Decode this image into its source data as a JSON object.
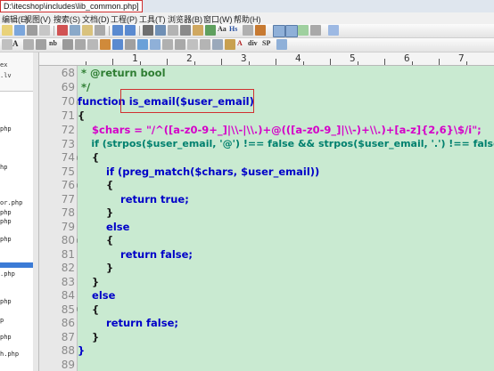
{
  "window": {
    "path": "D:\\itecshop\\includes\\lib_common.php]"
  },
  "menu": [
    "编辑(E)",
    "视图(V)",
    "搜索(S)",
    "文档(D)",
    "工程(P)",
    "工具(T)",
    "浏览器(B)",
    "窗口(W)",
    "帮助(H)"
  ],
  "toolbar": {
    "aa": "Aa",
    "hs": "Hs",
    "nb": "nb",
    "div": "div",
    "sp": "SP"
  },
  "sidebar": {
    "files": [
      "ex",
      ".lv",
      "",
      "php",
      "",
      "",
      "",
      "hp",
      "",
      "",
      "",
      "or.php",
      "php",
      "php",
      "",
      "php",
      "",
      "",
      "",
      "",
      ".php",
      "",
      "",
      "php",
      "",
      "p",
      "",
      "php",
      "",
      "h.php",
      ""
    ]
  },
  "ruler": {
    "labels": [
      "1",
      "2",
      "3",
      "4",
      "5",
      "6",
      "7"
    ]
  },
  "editor": {
    "lines": [
      {
        "n": "68",
        "text": " * @return bool"
      },
      {
        "n": "69",
        "text": " */"
      },
      {
        "n": "70",
        "text": "function is_email($user_email)"
      },
      {
        "n": "71",
        "text": "{"
      },
      {
        "n": "72",
        "text": "    $chars = \"/^([a-z0-9+_]|\\\\-|\\\\.)+@(([a-z0-9_]|\\\\-)+\\\\.)+[a-z]{2,6}\\$/i\";"
      },
      {
        "n": "73",
        "text": "    if (strpos($user_email, '@') !== false && strpos($user_email, '.') !== false)"
      },
      {
        "n": "74",
        "text": "    {"
      },
      {
        "n": "75",
        "text": "        if (preg_match($chars, $user_email))"
      },
      {
        "n": "76",
        "text": "        {"
      },
      {
        "n": "77",
        "text": "            return true;"
      },
      {
        "n": "78",
        "text": "        }"
      },
      {
        "n": "79",
        "text": "        else"
      },
      {
        "n": "80",
        "text": "        {"
      },
      {
        "n": "81",
        "text": "            return false;"
      },
      {
        "n": "82",
        "text": "        }"
      },
      {
        "n": "83",
        "text": "    }"
      },
      {
        "n": "84",
        "text": "    else"
      },
      {
        "n": "85",
        "text": "    {"
      },
      {
        "n": "86",
        "text": "        return false;"
      },
      {
        "n": "87",
        "text": "    }"
      },
      {
        "n": "88",
        "text": "}"
      },
      {
        "n": "89",
        "text": ""
      }
    ]
  },
  "colors": {
    "editor_bg": "#c9ead1",
    "keyword": "#0000c8",
    "variable": "#00806e",
    "string": "#d400c8",
    "comment": "#2e7d32",
    "highlight_box": "#d03030"
  }
}
